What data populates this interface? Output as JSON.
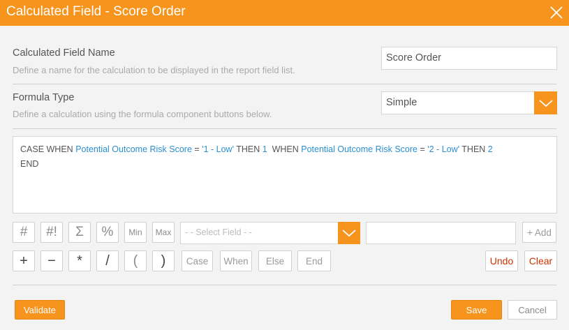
{
  "window": {
    "title": "Calculated Field - Score Order"
  },
  "name_section": {
    "label": "Calculated Field Name",
    "description": "Define a name for the calculation to be displayed in the report field list.",
    "value": "Score Order"
  },
  "type_section": {
    "label": "Formula Type",
    "description": "Define a calculation using the formula component buttons below.",
    "selected": "Simple"
  },
  "formula": {
    "t1": "CASE WHEN ",
    "f1": "Potential Outcome Risk Score",
    "t2": " = ",
    "l1": "'1 - Low'",
    "t3": " THEN ",
    "n1": "1",
    "t4": "  WHEN ",
    "f2": "Potential Outcome Risk Score",
    "t5": " = ",
    "l2": "'2 - Low'",
    "t6": " THEN ",
    "n2": "2",
    "t7": "END"
  },
  "toolbar": {
    "row1": {
      "count": "#",
      "count_distinct": "#!",
      "sum": "Σ",
      "percent": "%",
      "min": "Min",
      "max": "Max",
      "select_field_placeholder": "- - Select Field - -",
      "add": "+ Add"
    },
    "row2": {
      "plus": "+",
      "minus": "−",
      "multiply": "*",
      "divide": "/",
      "open_paren": "(",
      "close_paren": ")",
      "case": "Case",
      "when": "When",
      "else": "Else",
      "end": "End",
      "undo": "Undo",
      "clear": "Clear"
    }
  },
  "footer": {
    "validate": "Validate",
    "save": "Save",
    "cancel": "Cancel"
  },
  "colors": {
    "accent": "#f7941d",
    "field_blue": "#2a8fd0",
    "danger": "#cc3300"
  }
}
